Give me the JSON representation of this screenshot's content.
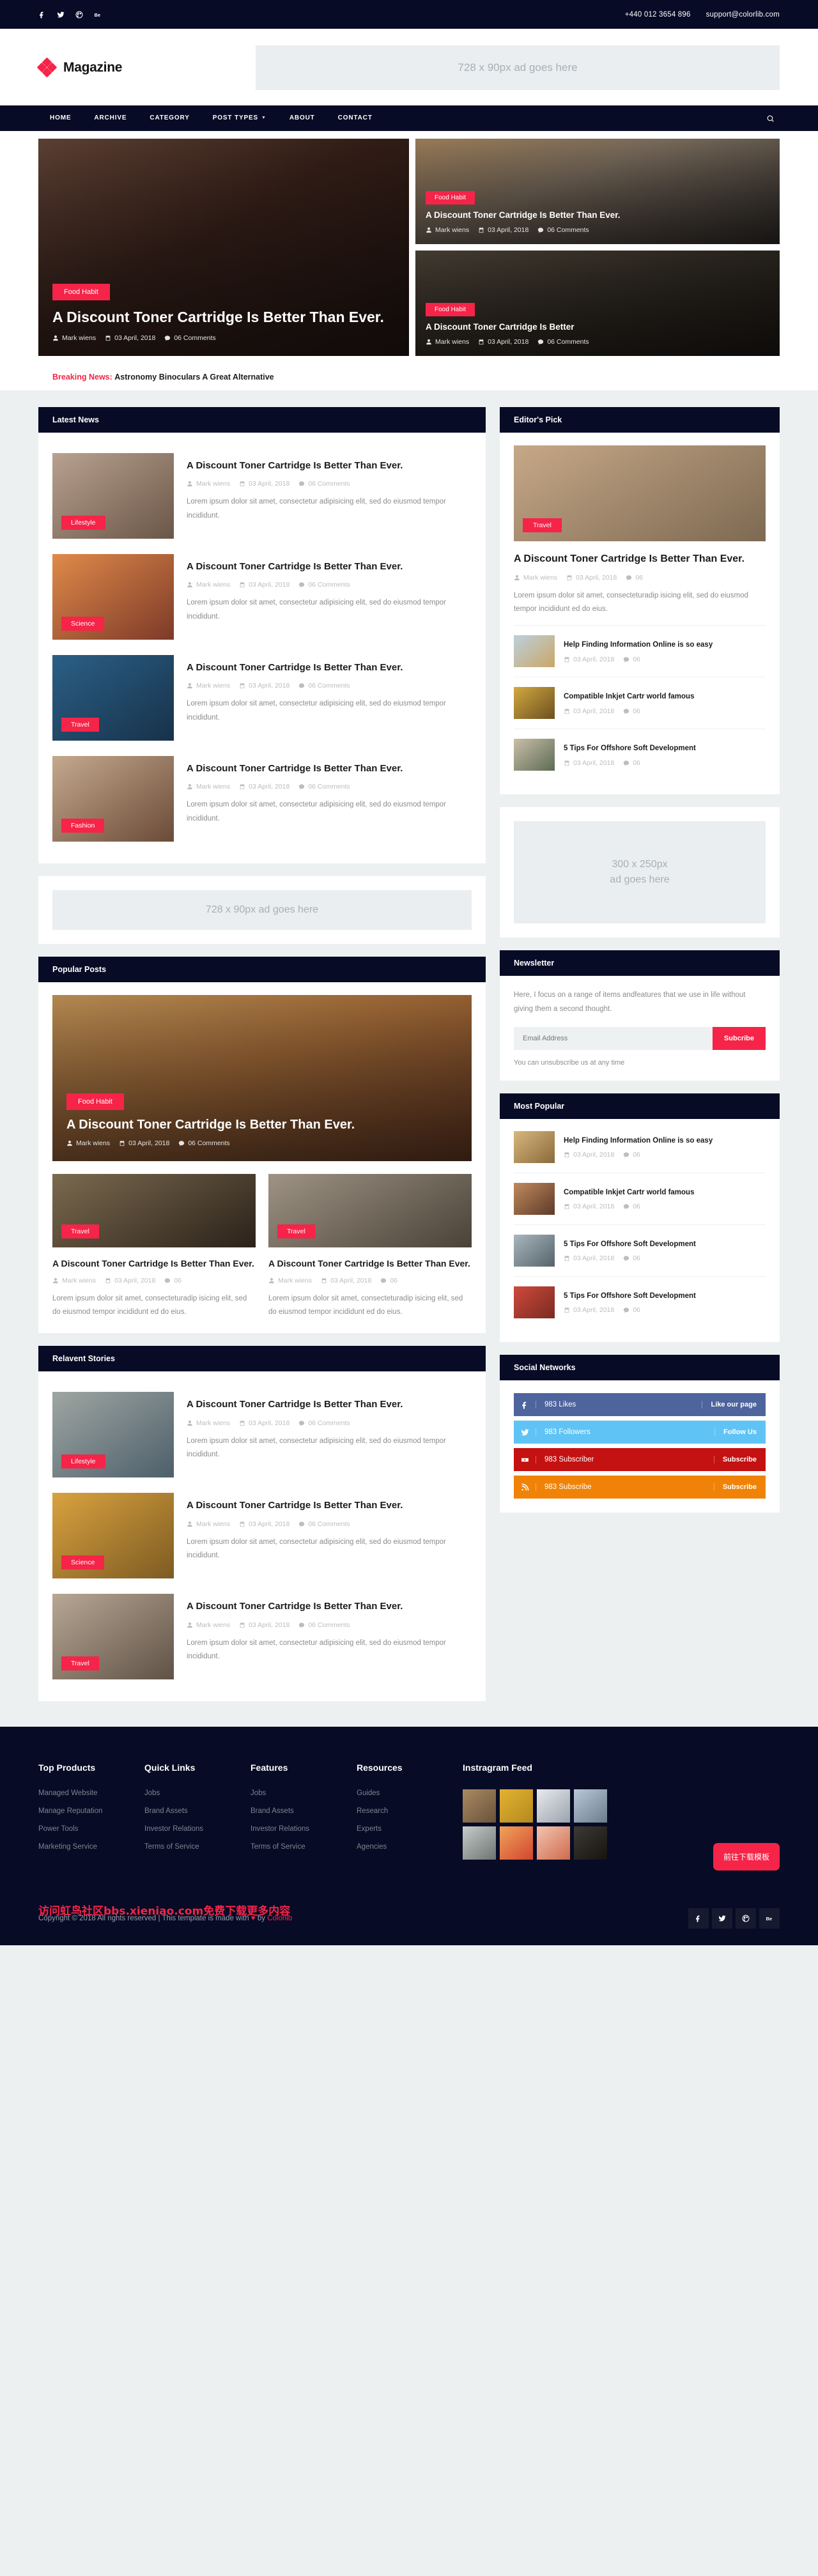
{
  "topbar": {
    "social": [
      "facebook-icon",
      "twitter-icon",
      "dribbble-icon",
      "behance-icon"
    ],
    "phone": "+440 012 3654 896",
    "email": "support@colorlib.com"
  },
  "brand": {
    "name": "Magazine"
  },
  "ads": {
    "top": "728 x 90px ad goes here",
    "middle": "728 x 90px ad goes here",
    "sidebar_line1": "300 x 250px",
    "sidebar_line2": "ad goes here"
  },
  "nav": {
    "items": [
      {
        "label": "HOME",
        "has_dropdown": false
      },
      {
        "label": "ARCHIVE",
        "has_dropdown": false
      },
      {
        "label": "CATEGORY",
        "has_dropdown": false
      },
      {
        "label": "POST TYPES",
        "has_dropdown": true
      },
      {
        "label": "ABOUT",
        "has_dropdown": false
      },
      {
        "label": "CONTACT",
        "has_dropdown": false
      }
    ]
  },
  "hero": {
    "featured": {
      "category": "Food Habit",
      "title": "A Discount Toner Cartridge Is Better Than Ever.",
      "author": "Mark wiens",
      "date": "03 April, 2018",
      "comments": "06 Comments"
    },
    "side": [
      {
        "category": "Food Habit",
        "title": "A Discount Toner Cartridge Is Better Than Ever.",
        "author": "Mark wiens",
        "date": "03 April, 2018",
        "comments": "06 Comments"
      },
      {
        "category": "Food Habit",
        "title": "A Discount Toner Cartridge Is Better",
        "author": "Mark wiens",
        "date": "03 April, 2018",
        "comments": "06 Comments"
      }
    ]
  },
  "breaking": {
    "label": "Breaking News:",
    "headline": "Astronomy Binoculars A Great Alternative"
  },
  "latest_news": {
    "heading": "Latest News",
    "items": [
      {
        "category": "Lifestyle",
        "title": "A Discount Toner Cartridge Is Better Than Ever.",
        "author": "Mark wiens",
        "date": "03 April, 2018",
        "comments": "06 Comments",
        "excerpt": "Lorem ipsum dolor sit amet, consectetur adipisicing elit, sed do eiusmod tempor incididunt."
      },
      {
        "category": "Science",
        "title": "A Discount Toner Cartridge Is Better Than Ever.",
        "author": "Mark wiens",
        "date": "03 April, 2018",
        "comments": "06 Comments",
        "excerpt": "Lorem ipsum dolor sit amet, consectetur adipisicing elit, sed do eiusmod tempor incididunt."
      },
      {
        "category": "Travel",
        "title": "A Discount Toner Cartridge Is Better Than Ever.",
        "author": "Mark wiens",
        "date": "03 April, 2018",
        "comments": "06 Comments",
        "excerpt": "Lorem ipsum dolor sit amet, consectetur adipisicing elit, sed do eiusmod tempor incididunt."
      },
      {
        "category": "Fashion",
        "title": "A Discount Toner Cartridge Is Better Than Ever.",
        "author": "Mark wiens",
        "date": "03 April, 2018",
        "comments": "06 Comments",
        "excerpt": "Lorem ipsum dolor sit amet, consectetur adipisicing elit, sed do eiusmod tempor incididunt."
      }
    ]
  },
  "popular_posts": {
    "heading": "Popular Posts",
    "featured": {
      "category": "Food Habit",
      "title": "A Discount Toner Cartridge Is Better Than Ever.",
      "author": "Mark wiens",
      "date": "03 April, 2018",
      "comments": "06 Comments"
    },
    "items": [
      {
        "category": "Travel",
        "title": "A Discount Toner Cartridge Is Better Than Ever.",
        "author": "Mark wiens",
        "date": "03 April, 2018",
        "comments": "06",
        "excerpt": "Lorem ipsum dolor sit amet, consecteturadip isicing elit, sed do eiusmod tempor incididunt ed do eius."
      },
      {
        "category": "Travel",
        "title": "A Discount Toner Cartridge Is Better Than Ever.",
        "author": "Mark wiens",
        "date": "03 April, 2018",
        "comments": "06",
        "excerpt": "Lorem ipsum dolor sit amet, consecteturadip isicing elit, sed do eiusmod tempor incididunt ed do eius."
      }
    ]
  },
  "relevant_stories": {
    "heading": "Relavent Stories",
    "items": [
      {
        "category": "Lifestyle",
        "title": "A Discount Toner Cartridge Is Better Than Ever.",
        "author": "Mark wiens",
        "date": "03 April, 2018",
        "comments": "06 Comments",
        "excerpt": "Lorem ipsum dolor sit amet, consectetur adipisicing elit, sed do eiusmod tempor incididunt."
      },
      {
        "category": "Science",
        "title": "A Discount Toner Cartridge Is Better Than Ever.",
        "author": "Mark wiens",
        "date": "03 April, 2018",
        "comments": "06 Comments",
        "excerpt": "Lorem ipsum dolor sit amet, consectetur adipisicing elit, sed do eiusmod tempor incididunt."
      },
      {
        "category": "Travel",
        "title": "A Discount Toner Cartridge Is Better Than Ever.",
        "author": "Mark wiens",
        "date": "03 April, 2018",
        "comments": "06 Comments",
        "excerpt": "Lorem ipsum dolor sit amet, consectetur adipisicing elit, sed do eiusmod tempor incididunt."
      }
    ]
  },
  "editors_pick": {
    "heading": "Editor's Pick",
    "featured": {
      "category": "Travel",
      "title": "A Discount Toner Cartridge Is Better Than Ever.",
      "author": "Mark wiens",
      "date": "03 April, 2018",
      "comments": "06",
      "excerpt": "Lorem ipsum dolor sit amet, consecteturadip isicing elit, sed do eiusmod tempor incididunt ed do eius."
    },
    "items": [
      {
        "title": "Help Finding Information Online is so easy",
        "date": "03 April, 2018",
        "comments": "06"
      },
      {
        "title": "Compatible Inkjet Cartr world famous",
        "date": "03 April, 2018",
        "comments": "06"
      },
      {
        "title": "5 Tips For Offshore Soft Development",
        "date": "03 April, 2018",
        "comments": "06"
      }
    ]
  },
  "newsletter": {
    "heading": "Newsletter",
    "text": "Here, I focus on a range of items andfeatures that we use in life without giving them a second thought.",
    "placeholder": "Email Address",
    "button": "Subcribe",
    "note": "You can unsubscribe us at any time"
  },
  "most_popular": {
    "heading": "Most Popular",
    "items": [
      {
        "title": "Help Finding Information Online is so easy",
        "date": "03 April, 2018",
        "comments": "06"
      },
      {
        "title": "Compatible Inkjet Cartr world famous",
        "date": "03 April, 2018",
        "comments": "06"
      },
      {
        "title": "5 Tips For Offshore Soft Development",
        "date": "03 April, 2018",
        "comments": "06"
      },
      {
        "title": "5 Tips For Offshore Soft Development",
        "date": "03 April, 2018",
        "comments": "06"
      }
    ]
  },
  "social_networks": {
    "heading": "Social Networks",
    "items": [
      {
        "network": "facebook",
        "icon": "facebook-icon",
        "count": "983 Likes",
        "action": "Like our page",
        "color": "#4d649d"
      },
      {
        "network": "twitter",
        "icon": "twitter-icon",
        "count": "983 Followers",
        "action": "Follow Us",
        "color": "#5fc4f5"
      },
      {
        "network": "youtube",
        "icon": "youtube-icon",
        "count": "983 Subscriber",
        "action": "Subscribe",
        "color": "#c41111"
      },
      {
        "network": "rss",
        "icon": "rss-icon",
        "count": "983 Subscribe",
        "action": "Subscribe",
        "color": "#f08307"
      }
    ]
  },
  "footer": {
    "columns": [
      {
        "heading": "Top Products",
        "links": [
          "Managed Website",
          "Manage Reputation",
          "Power Tools",
          "Marketing Service"
        ]
      },
      {
        "heading": "Quick Links",
        "links": [
          "Jobs",
          "Brand Assets",
          "Investor Relations",
          "Terms of Service"
        ]
      },
      {
        "heading": "Features",
        "links": [
          "Jobs",
          "Brand Assets",
          "Investor Relations",
          "Terms of Service"
        ]
      },
      {
        "heading": "Resources",
        "links": [
          "Guides",
          "Research",
          "Experts",
          "Agencies"
        ]
      }
    ],
    "instagram_heading": "Instragram Feed",
    "copyright_prefix": "Copyright ©",
    "copyright_year": "2018",
    "copyright_mid": "All rights reserved | This template is made with",
    "copyright_by": "by",
    "copyright_link": "Colorlib",
    "social": [
      "facebook-icon",
      "twitter-icon",
      "dribbble-icon",
      "behance-icon"
    ],
    "watermark": "访问虹鸟社区bbs.xieniao.com免费下载更多内容",
    "download_button": "前往下载模板"
  },
  "colors": {
    "accent": "#f52448",
    "dark": "#070b25",
    "page_bg": "#ecf0f1"
  }
}
